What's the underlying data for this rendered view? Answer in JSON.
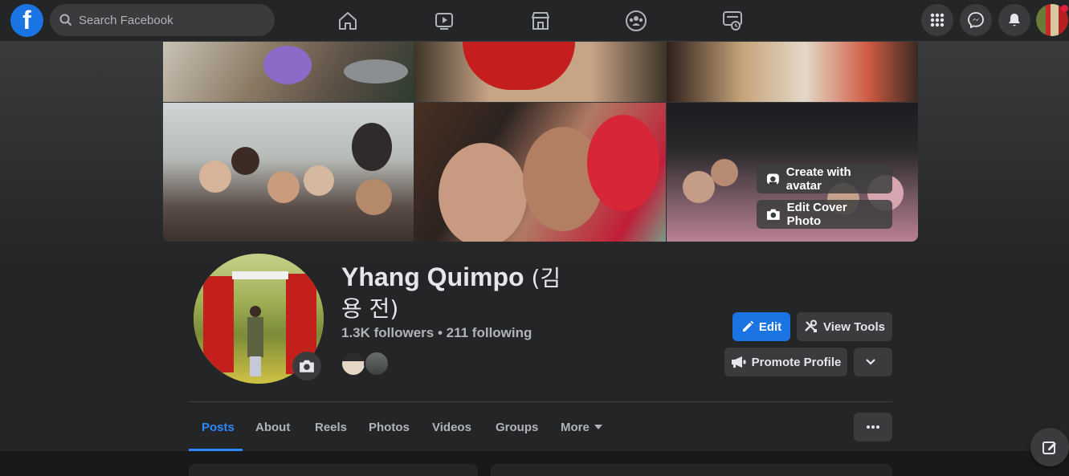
{
  "nav": {
    "logo": "f",
    "search_placeholder": "Search Facebook",
    "icons": [
      "home-icon",
      "watch-icon",
      "marketplace-icon",
      "groups-icon",
      "memories-icon"
    ],
    "right_icons": [
      "menu-grid-icon",
      "messenger-icon",
      "notifications-icon",
      "account-avatar"
    ]
  },
  "cover": {
    "create_avatar_label": "Create with avatar",
    "edit_cover_label": "Edit Cover Photo"
  },
  "profile": {
    "name": "Yhang Quimpo",
    "name_korean": "(김 용 전)",
    "followers_text": "1.3K followers • 211 following"
  },
  "actions": {
    "edit_label": "Edit",
    "view_tools_label": "View Tools",
    "promote_label": "Promote Profile"
  },
  "tabs": [
    {
      "label": "Posts",
      "active": true
    },
    {
      "label": "About"
    },
    {
      "label": "Reels"
    },
    {
      "label": "Photos"
    },
    {
      "label": "Videos"
    },
    {
      "label": "Groups"
    },
    {
      "label": "More"
    }
  ],
  "colors": {
    "accent": "#1b74e4",
    "active_tab": "#2d88ff",
    "background": "#18191a",
    "surface": "#242526"
  }
}
